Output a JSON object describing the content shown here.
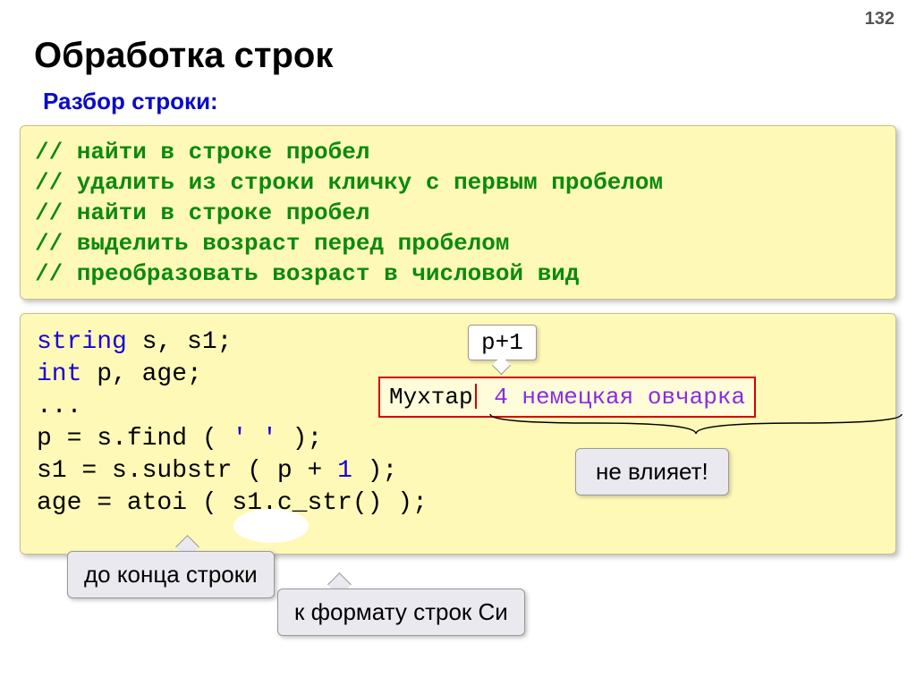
{
  "page_number": "132",
  "title": "Обработка строк",
  "subtitle": "Разбор строки:",
  "comments": {
    "l1": "// найти в строке пробел",
    "l2": "// удалить из строки кличку с первым пробелом",
    "l3": "// найти в строке пробел",
    "l4": "// выделить возраст перед пробелом",
    "l5": "// преобразовать возраст в числовой вид"
  },
  "code": {
    "kw_string": "string",
    "decl_s": " s, s1;",
    "kw_int": "int",
    "decl_p": " p, age;",
    "dots": "...",
    "find_lhs": "p = s.find ( ",
    "space_lit": "' '",
    "find_rhs": " );",
    "substr_l": "s1 = s.substr ( p + ",
    "one": "1",
    "substr_r": " );",
    "atoi_l": "age = atoi ( s1",
    "atoi_hidden": ".c",
    "atoi_r": "_str() );"
  },
  "example": {
    "head": "Мухтар",
    "tail": " 4 немецкая овчарка"
  },
  "callouts": {
    "p1": "p+1",
    "notaffect": "не влияет!",
    "to_end": "до конца строки",
    "cformat": "к формату строк Си"
  }
}
